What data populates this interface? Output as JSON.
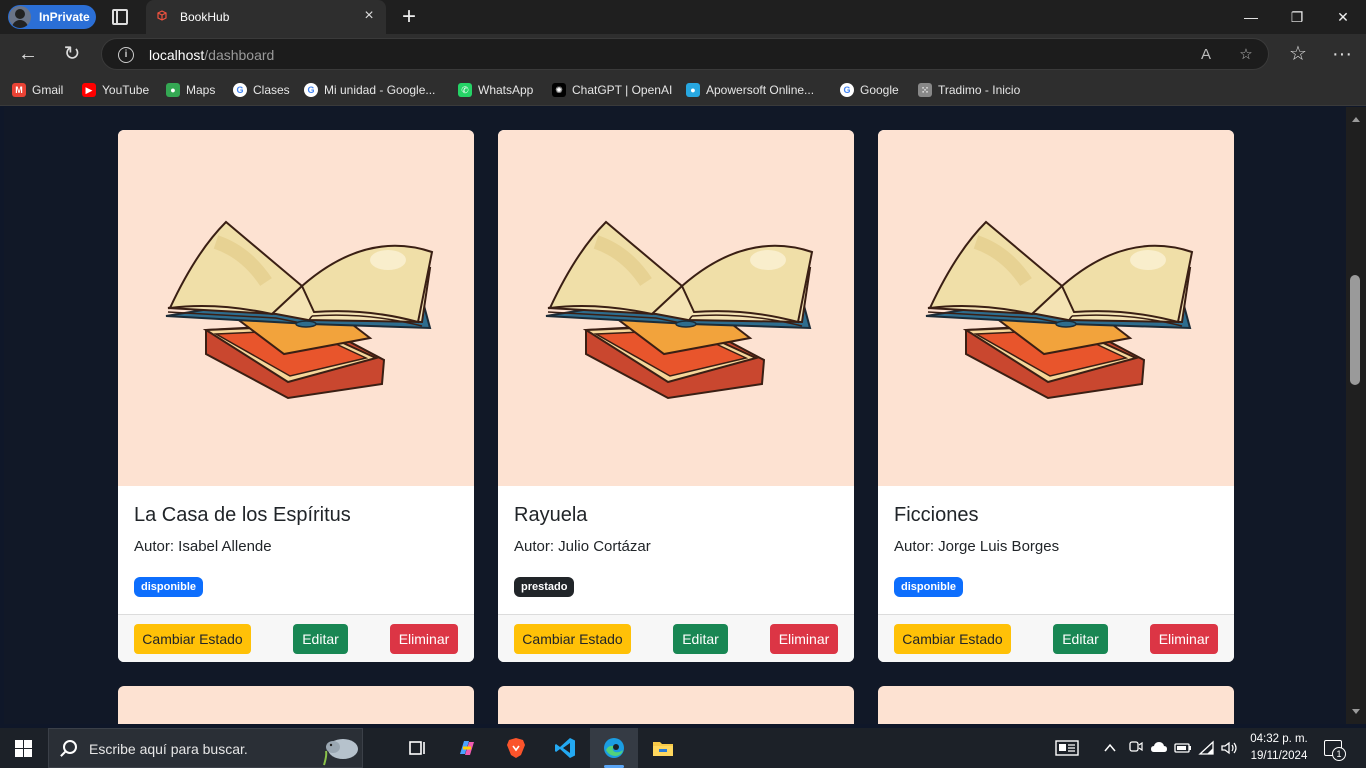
{
  "browser": {
    "inprivate_label": "InPrivate",
    "tab_title": "BookHub",
    "tab_close": "×",
    "new_tab": "+",
    "url_host": "localhost",
    "url_path": "/dashboard",
    "window_controls": {
      "minimize": "—",
      "restore": "❐",
      "close": "✕"
    },
    "nav": {
      "back": "←",
      "refresh": "↻",
      "read_aloud": "A",
      "favorite": "☆",
      "favorites": "☆",
      "more": "···"
    }
  },
  "bookmarks": [
    {
      "label": "Gmail",
      "icon": "gmail-icon",
      "color": "#ea4335",
      "glyph": "M"
    },
    {
      "label": "YouTube",
      "icon": "youtube-icon",
      "color": "#ff0000",
      "glyph": "▶"
    },
    {
      "label": "Maps",
      "icon": "maps-icon",
      "color": "#34a853",
      "glyph": "●"
    },
    {
      "label": "Clases",
      "icon": "google-icon",
      "color": "#ffffff",
      "glyph": "G"
    },
    {
      "label": "Mi unidad - Google...",
      "icon": "google-icon",
      "color": "#ffffff",
      "glyph": "G"
    },
    {
      "label": "WhatsApp",
      "icon": "whatsapp-icon",
      "color": "#25d366",
      "glyph": "✆"
    },
    {
      "label": "ChatGPT | OpenAI",
      "icon": "openai-icon",
      "color": "#000000",
      "glyph": "✺"
    },
    {
      "label": "Apowersoft Online...",
      "icon": "apowersoft-icon",
      "color": "#27a7e0",
      "glyph": "●"
    },
    {
      "label": "Google",
      "icon": "google-icon",
      "color": "#ffffff",
      "glyph": "G"
    },
    {
      "label": "Tradimo - Inicio",
      "icon": "grid-icon",
      "color": "#888888",
      "glyph": "⁙"
    }
  ],
  "books": [
    {
      "title": "La Casa de los Espíritus",
      "author": "Autor: Isabel Allende",
      "status": "disponible",
      "status_type": "available"
    },
    {
      "title": "Rayuela",
      "author": "Autor: Julio Cortázar",
      "status": "prestado",
      "status_type": "lent"
    },
    {
      "title": "Ficciones",
      "author": "Autor: Jorge Luis Borges",
      "status": "disponible",
      "status_type": "available"
    }
  ],
  "actions": {
    "change_status": "Cambiar Estado",
    "edit": "Editar",
    "delete": "Eliminar"
  },
  "colors": {
    "badge_available": "#0d6efd",
    "badge_lent": "#212529",
    "warning": "#ffc107",
    "success": "#198754",
    "danger": "#dc3545",
    "page_bg": "#111827",
    "card_image_bg": "#fde2d2"
  },
  "taskbar": {
    "search_placeholder": "Escribe aquí para buscar.",
    "time": "04:32 p. m.",
    "date": "19/11/2024",
    "notification_count": "1"
  }
}
